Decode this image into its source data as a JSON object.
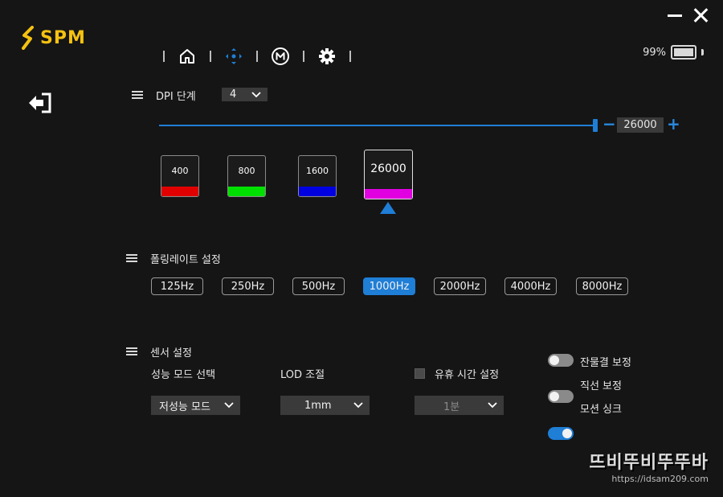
{
  "app": {
    "logo_text": "SPM",
    "accent": "#1f7ed6",
    "brand": "#f5c211"
  },
  "window": {
    "minimize": "minimize-icon",
    "close": "close-icon"
  },
  "nav": {
    "items": [
      "home-icon",
      "dpad-icon",
      "macro-icon",
      "gear-icon"
    ],
    "active": "dpad-icon"
  },
  "battery": {
    "percent_label": "99%",
    "level": 0.99
  },
  "dpi": {
    "title": "DPI 단계",
    "stage_count": "4",
    "value": "26000",
    "minus": "−",
    "plus": "+",
    "stages": [
      {
        "value": "400",
        "color": "#e00000"
      },
      {
        "value": "800",
        "color": "#00e000"
      },
      {
        "value": "1600",
        "color": "#0000e0"
      },
      {
        "value": "26000",
        "color": "#e000e0",
        "active": true
      }
    ]
  },
  "polling": {
    "title": "폴링레이트 설정",
    "options": [
      "125Hz",
      "250Hz",
      "500Hz",
      "1000Hz",
      "2000Hz",
      "4000Hz",
      "8000Hz"
    ],
    "selected": "1000Hz"
  },
  "sensor": {
    "title": "센서 설정",
    "performance_mode": {
      "label": "성능 모드 선택",
      "value": "저성능 모드"
    },
    "lod": {
      "label": "LOD 조절",
      "value": "1mm"
    },
    "idle_time": {
      "label": "유휴 시간 설정",
      "value": "1분",
      "checked": false
    },
    "toggles": [
      {
        "label": "잔물결 보정",
        "on": false
      },
      {
        "label": "직선 보정",
        "on": false
      },
      {
        "label": "모션 싱크",
        "on": true
      }
    ]
  },
  "watermark": {
    "title": "뜨비뚜비뚜뚜바",
    "url": "https://idsam209.com"
  }
}
